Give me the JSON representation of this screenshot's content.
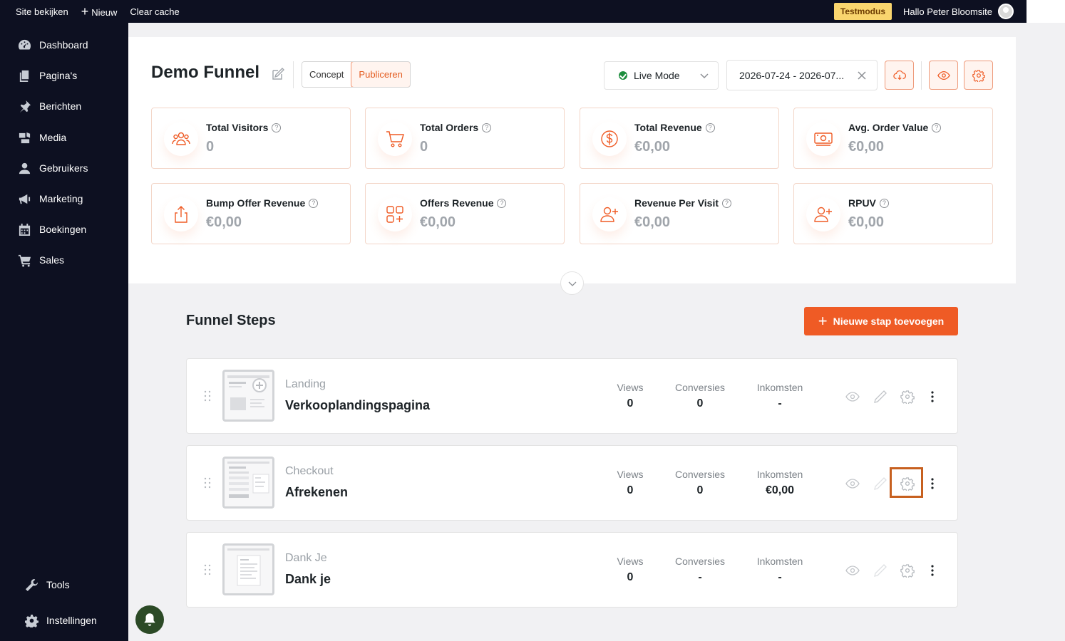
{
  "adminbar": {
    "site_view": "Site bekijken",
    "new_label": "Nieuw",
    "clear_cache": "Clear cache",
    "testmode": "Testmodus",
    "greeting": "Hallo Peter Bloomsite"
  },
  "sidebar": {
    "items": [
      {
        "label": "Dashboard",
        "icon": "dashboard-icon"
      },
      {
        "label": "Pagina's",
        "icon": "pages-icon"
      },
      {
        "label": "Berichten",
        "icon": "pin-icon"
      },
      {
        "label": "Media",
        "icon": "media-icon"
      },
      {
        "label": "Gebruikers",
        "icon": "user-icon"
      },
      {
        "label": "Marketing",
        "icon": "megaphone-icon"
      },
      {
        "label": "Boekingen",
        "icon": "calendar-icon"
      },
      {
        "label": "Sales",
        "icon": "cart-icon"
      }
    ],
    "bottom": [
      {
        "label": "Tools",
        "icon": "wrench-icon"
      },
      {
        "label": "Instellingen",
        "icon": "gear-icon"
      }
    ]
  },
  "header": {
    "title": "Demo Funnel",
    "status_options": [
      "Concept",
      "Publiceren"
    ],
    "status_selected": "Publiceren",
    "mode_select": "Live Mode",
    "date_range": "2026-07-24 - 2026-07..."
  },
  "stats": [
    {
      "label": "Total Visitors",
      "value": "0",
      "icon": "users-icon"
    },
    {
      "label": "Total Orders",
      "value": "0",
      "icon": "cart-icon"
    },
    {
      "label": "Total Revenue",
      "value": "€0,00",
      "icon": "dollar-icon"
    },
    {
      "label": "Avg. Order Value",
      "value": "€0,00",
      "icon": "cash-icon"
    },
    {
      "label": "Bump Offer Revenue",
      "value": "€0,00",
      "icon": "share-icon"
    },
    {
      "label": "Offers Revenue",
      "value": "€0,00",
      "icon": "grid-plus-icon"
    },
    {
      "label": "Revenue Per Visit",
      "value": "€0,00",
      "icon": "user-plus-icon"
    },
    {
      "label": "RPUV",
      "value": "€0,00",
      "icon": "user-plus-icon"
    }
  ],
  "steps_section": {
    "title": "Funnel Steps",
    "add_button": "Nieuwe stap toevoegen",
    "metric_headers": [
      "Views",
      "Conversies",
      "Inkomsten"
    ]
  },
  "steps": [
    {
      "type": "Landing",
      "name": "Verkooplandingspagina",
      "views": "0",
      "conversions": "0",
      "revenue": "-"
    },
    {
      "type": "Checkout",
      "name": "Afrekenen",
      "views": "0",
      "conversions": "0",
      "revenue": "€0,00"
    },
    {
      "type": "Dank Je",
      "name": "Dank je",
      "views": "0",
      "conversions": "-",
      "revenue": "-"
    }
  ],
  "colors": {
    "accent": "#ef5b25",
    "sidebar_bg": "#0d1021",
    "testmode_bg": "#f9d56e",
    "live_dot": "#1e8e3e"
  }
}
